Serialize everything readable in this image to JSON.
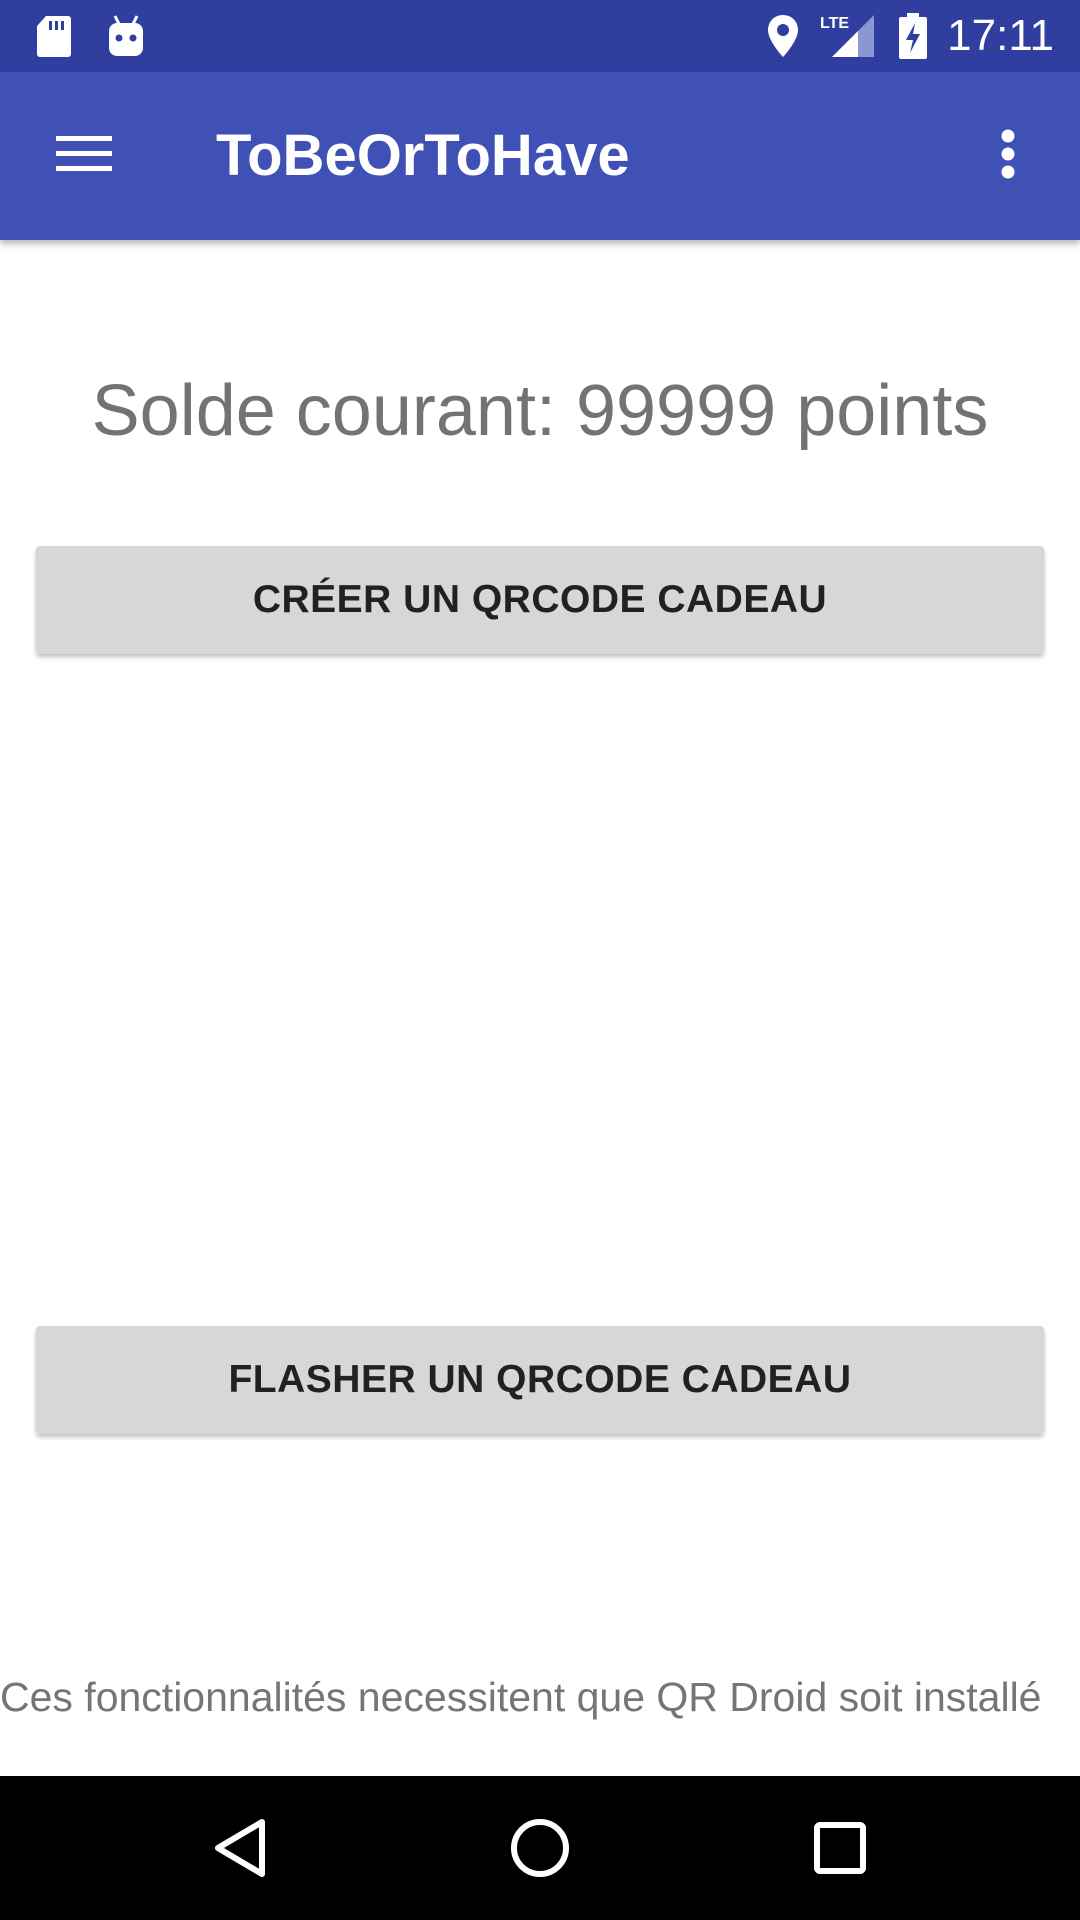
{
  "status_bar": {
    "time": "17:11",
    "icons": [
      "sd-card-icon",
      "android-debug-icon",
      "location-icon",
      "lte-signal-icon",
      "battery-charging-icon"
    ],
    "lte_label": "LTE"
  },
  "app_bar": {
    "title": "ToBeOrToHave",
    "menu_icon": "hamburger-menu-icon",
    "overflow_icon": "more-vert-icon"
  },
  "main": {
    "balance_text": "Solde courant: 99999 points",
    "create_button_label": "CRÉER UN QRCODE CADEAU",
    "scan_button_label": "FLASHER UN QRCODE CADEAU",
    "footer_note": "Ces fonctionnalités necessitent que QR Droid soit installé"
  },
  "nav_bar": {
    "icons": [
      "back-icon",
      "home-icon",
      "recents-icon"
    ]
  },
  "colors": {
    "status_bar": "#303f9f",
    "app_bar": "#3f51b5",
    "button_bg": "#d6d7d7",
    "nav_bar": "#000000"
  }
}
